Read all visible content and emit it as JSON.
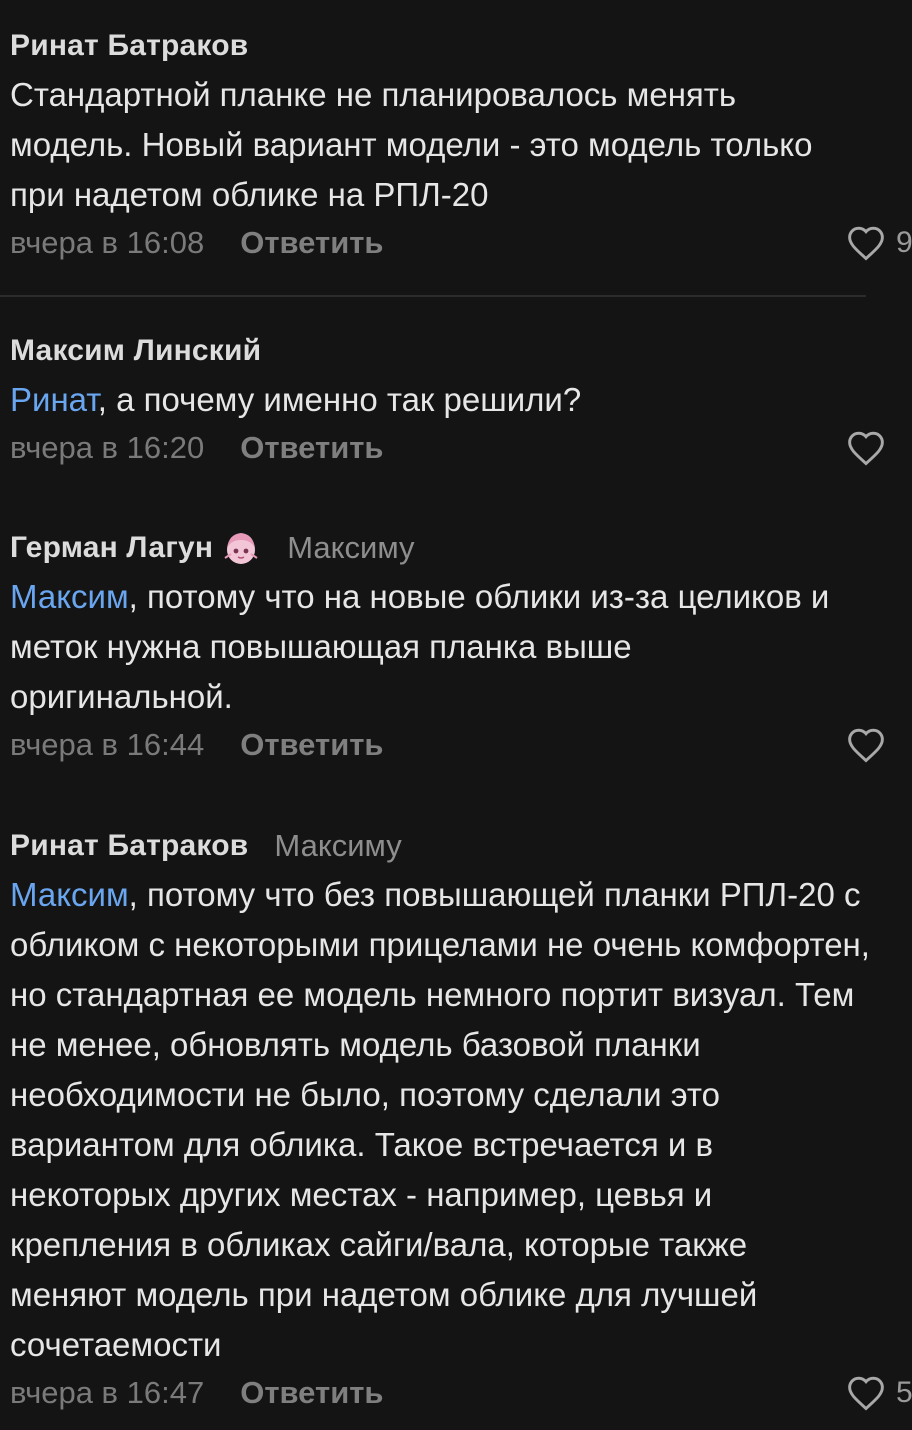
{
  "comments": [
    {
      "author": "Ринат Батраков",
      "reply_to": "",
      "mention": "",
      "text": "Стандартной планке не планировалось менять модель. Новый вариант модели - это модель только при надетом облике на РПЛ-20",
      "time": "вчера в 16:08",
      "reply_label": "Ответить",
      "likes": "9"
    },
    {
      "author": "Максим Линский",
      "reply_to": "",
      "mention": "Ринат",
      "text": ", а почему именно так решили?",
      "time": "вчера в 16:20",
      "reply_label": "Ответить",
      "likes": ""
    },
    {
      "author": "Герман Лагун",
      "reply_to": "Максиму",
      "mention": "Максим",
      "text": ", потому что на новые облики из-за целиков и меток нужна повышающая планка выше оригинальной.",
      "time": "вчера в 16:44",
      "reply_label": "Ответить",
      "likes": ""
    },
    {
      "author": "Ринат Батраков",
      "reply_to": "Максиму",
      "mention": "Максим",
      "text": ", потому что без повышающей планки РПЛ-20 с обликом с некоторыми прицелами не очень комфортен, но стандартная ее модель немного портит визуал. Тем не менее, обновлять модель базовой планки необходимости не было, поэтому сделали это вариантом для облика. Такое встречается и в некоторых других местах - например, цевья и крепления в обликах сайги/вала, которые также меняют модель при надетом облике для лучшей сочетаемости",
      "time": "вчера в 16:47",
      "reply_label": "Ответить",
      "likes": "5"
    }
  ],
  "colors": {
    "background": "#141414",
    "mention": "#6aa6f0",
    "meta": "#7a7a7a"
  },
  "icons": {
    "like": "heart-outline-icon",
    "sticker": "anime-avatar-sticker"
  }
}
